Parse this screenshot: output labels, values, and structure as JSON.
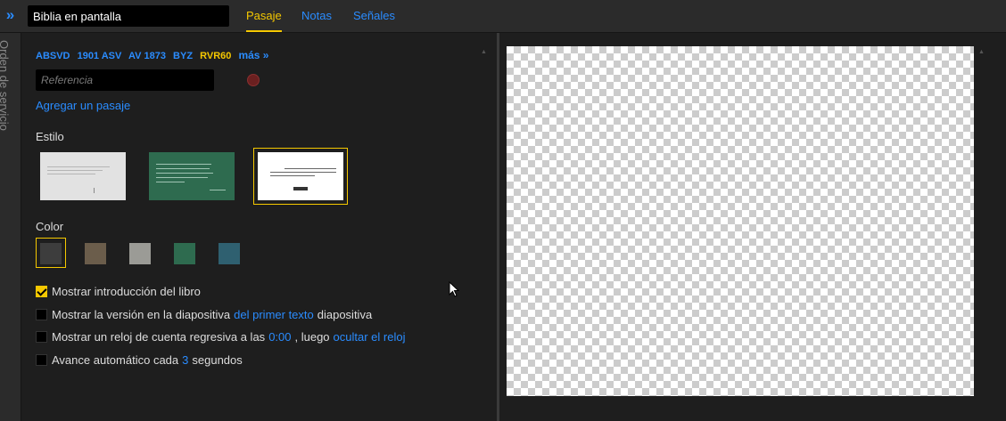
{
  "header": {
    "title_value": "Biblia en pantalla",
    "expand_glyph": "»",
    "tabs": [
      {
        "label": "Pasaje",
        "active": true
      },
      {
        "label": "Notas",
        "active": false
      },
      {
        "label": "Señales",
        "active": false
      }
    ]
  },
  "sidebar": {
    "label": "Orden de servicio"
  },
  "passage": {
    "versions": [
      "ABSVD",
      "1901 ASV",
      "AV 1873",
      "BYZ",
      "RVR60"
    ],
    "active_version": "RVR60",
    "more_label": "más »",
    "reference_placeholder": "Referencia",
    "add_passage_label": "Agregar un pasaje"
  },
  "style": {
    "label": "Estilo",
    "thumbnails": [
      {
        "name": "light-gray",
        "bg": "#e2e2e2",
        "selected": false
      },
      {
        "name": "green",
        "bg": "#2e6b4f",
        "selected": false
      },
      {
        "name": "white",
        "bg": "#ffffff",
        "selected": true
      }
    ]
  },
  "color": {
    "label": "Color",
    "swatches": [
      "#3d3d3d",
      "#6b5d4b",
      "#9b9b96",
      "#2e6b4f",
      "#2f6070"
    ],
    "selected_index": 0
  },
  "options": {
    "book_intro": {
      "label": "Mostrar introducción del libro",
      "checked": true
    },
    "show_version": {
      "prefix": "Mostrar la versión en la diapositiva",
      "link": "del primer texto",
      "suffix": "diapositiva",
      "checked": false
    },
    "countdown": {
      "prefix": "Mostrar un reloj de cuenta regresiva a las",
      "time": "0:00",
      "middle": ", luego",
      "link": "ocultar el reloj",
      "checked": false
    },
    "auto_advance": {
      "prefix": "Avance automático cada",
      "seconds": "3",
      "suffix": "segundos",
      "checked": false
    }
  },
  "colors": {
    "accent": "#f5c800",
    "link": "#2a8cff",
    "record": "#6b2020"
  }
}
